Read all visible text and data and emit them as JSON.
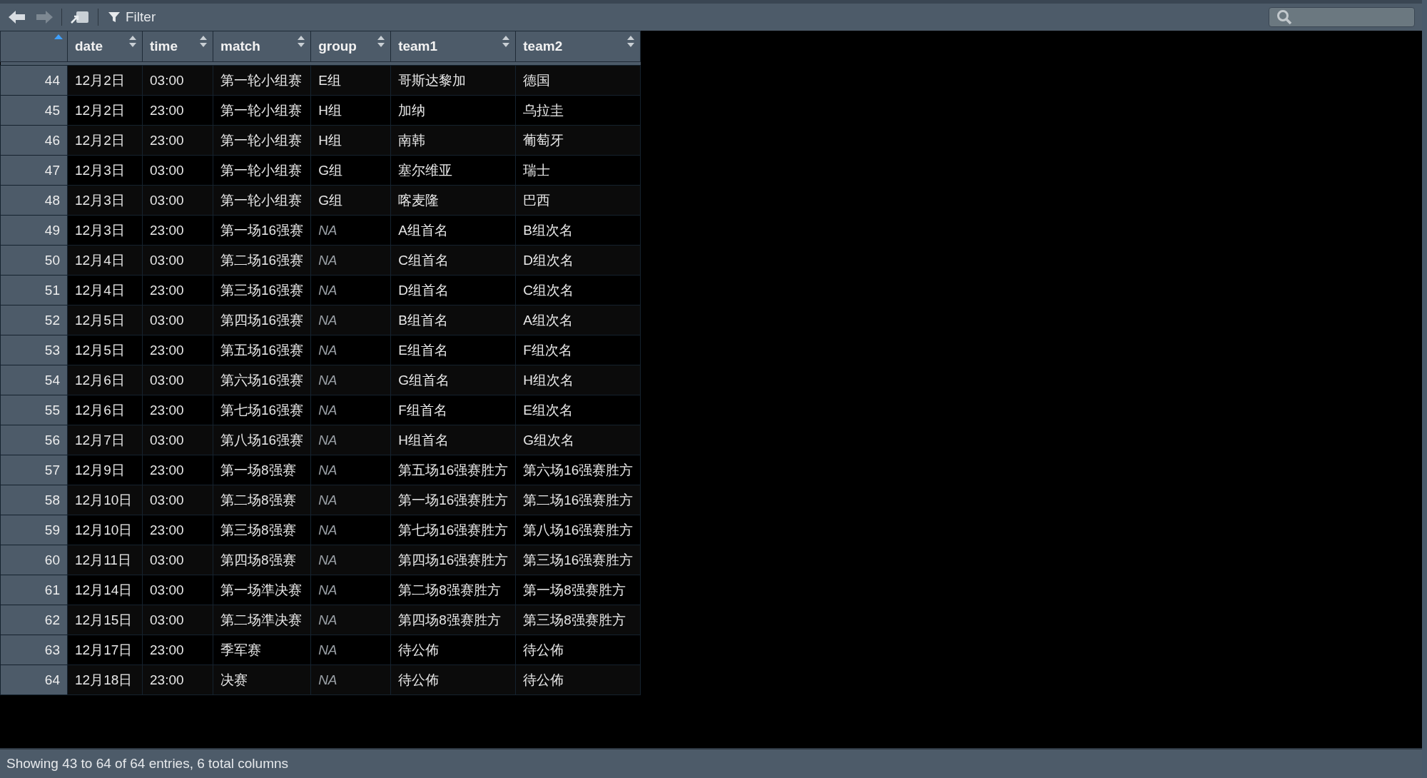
{
  "toolbar": {
    "back": {
      "disabled": false
    },
    "forward": {
      "disabled": true
    },
    "filter_label": "Filter"
  },
  "table": {
    "index_header": {
      "sorted_ascending": true
    },
    "columns": [
      {
        "label": "date",
        "sorted_ascending": false
      },
      {
        "label": "time",
        "sorted_ascending": false
      },
      {
        "label": "match",
        "sorted_ascending": false
      },
      {
        "label": "group",
        "sorted_ascending": false
      },
      {
        "label": "team1",
        "sorted_ascending": false
      },
      {
        "label": "team2",
        "sorted_ascending": false
      }
    ],
    "rows": [
      {
        "index": "44",
        "cells": [
          {
            "text": "12月2日",
            "missing": false
          },
          {
            "text": "03:00",
            "missing": false
          },
          {
            "text": "第一轮小组赛",
            "missing": false
          },
          {
            "text": "E组",
            "missing": false
          },
          {
            "text": "哥斯达黎加",
            "missing": false
          },
          {
            "text": "德国",
            "missing": false
          }
        ]
      },
      {
        "index": "45",
        "cells": [
          {
            "text": "12月2日",
            "missing": false
          },
          {
            "text": "23:00",
            "missing": false
          },
          {
            "text": "第一轮小组赛",
            "missing": false
          },
          {
            "text": "H组",
            "missing": false
          },
          {
            "text": "加纳",
            "missing": false
          },
          {
            "text": "乌拉圭",
            "missing": false
          }
        ]
      },
      {
        "index": "46",
        "cells": [
          {
            "text": "12月2日",
            "missing": false
          },
          {
            "text": "23:00",
            "missing": false
          },
          {
            "text": "第一轮小组赛",
            "missing": false
          },
          {
            "text": "H组",
            "missing": false
          },
          {
            "text": "南韩",
            "missing": false
          },
          {
            "text": "葡萄牙",
            "missing": false
          }
        ]
      },
      {
        "index": "47",
        "cells": [
          {
            "text": "12月3日",
            "missing": false
          },
          {
            "text": "03:00",
            "missing": false
          },
          {
            "text": "第一轮小组赛",
            "missing": false
          },
          {
            "text": "G组",
            "missing": false
          },
          {
            "text": "塞尔维亚",
            "missing": false
          },
          {
            "text": "瑞士",
            "missing": false
          }
        ]
      },
      {
        "index": "48",
        "cells": [
          {
            "text": "12月3日",
            "missing": false
          },
          {
            "text": "03:00",
            "missing": false
          },
          {
            "text": "第一轮小组赛",
            "missing": false
          },
          {
            "text": "G组",
            "missing": false
          },
          {
            "text": "喀麦隆",
            "missing": false
          },
          {
            "text": "巴西",
            "missing": false
          }
        ]
      },
      {
        "index": "49",
        "cells": [
          {
            "text": "12月3日",
            "missing": false
          },
          {
            "text": "23:00",
            "missing": false
          },
          {
            "text": "第一场16强赛",
            "missing": false
          },
          {
            "text": "NA",
            "missing": true
          },
          {
            "text": "A组首名",
            "missing": false
          },
          {
            "text": "B组次名",
            "missing": false
          }
        ]
      },
      {
        "index": "50",
        "cells": [
          {
            "text": "12月4日",
            "missing": false
          },
          {
            "text": "03:00",
            "missing": false
          },
          {
            "text": "第二场16强赛",
            "missing": false
          },
          {
            "text": "NA",
            "missing": true
          },
          {
            "text": "C组首名",
            "missing": false
          },
          {
            "text": "D组次名",
            "missing": false
          }
        ]
      },
      {
        "index": "51",
        "cells": [
          {
            "text": "12月4日",
            "missing": false
          },
          {
            "text": "23:00",
            "missing": false
          },
          {
            "text": "第三场16强赛",
            "missing": false
          },
          {
            "text": "NA",
            "missing": true
          },
          {
            "text": "D组首名",
            "missing": false
          },
          {
            "text": "C组次名",
            "missing": false
          }
        ]
      },
      {
        "index": "52",
        "cells": [
          {
            "text": "12月5日",
            "missing": false
          },
          {
            "text": "03:00",
            "missing": false
          },
          {
            "text": "第四场16强赛",
            "missing": false
          },
          {
            "text": "NA",
            "missing": true
          },
          {
            "text": "B组首名",
            "missing": false
          },
          {
            "text": "A组次名",
            "missing": false
          }
        ]
      },
      {
        "index": "53",
        "cells": [
          {
            "text": "12月5日",
            "missing": false
          },
          {
            "text": "23:00",
            "missing": false
          },
          {
            "text": "第五场16强赛",
            "missing": false
          },
          {
            "text": "NA",
            "missing": true
          },
          {
            "text": "E组首名",
            "missing": false
          },
          {
            "text": "F组次名",
            "missing": false
          }
        ]
      },
      {
        "index": "54",
        "cells": [
          {
            "text": "12月6日",
            "missing": false
          },
          {
            "text": "03:00",
            "missing": false
          },
          {
            "text": "第六场16强赛",
            "missing": false
          },
          {
            "text": "NA",
            "missing": true
          },
          {
            "text": "G组首名",
            "missing": false
          },
          {
            "text": "H组次名",
            "missing": false
          }
        ]
      },
      {
        "index": "55",
        "cells": [
          {
            "text": "12月6日",
            "missing": false
          },
          {
            "text": "23:00",
            "missing": false
          },
          {
            "text": "第七场16强赛",
            "missing": false
          },
          {
            "text": "NA",
            "missing": true
          },
          {
            "text": "F组首名",
            "missing": false
          },
          {
            "text": "E组次名",
            "missing": false
          }
        ]
      },
      {
        "index": "56",
        "cells": [
          {
            "text": "12月7日",
            "missing": false
          },
          {
            "text": "03:00",
            "missing": false
          },
          {
            "text": "第八场16强赛",
            "missing": false
          },
          {
            "text": "NA",
            "missing": true
          },
          {
            "text": "H组首名",
            "missing": false
          },
          {
            "text": "G组次名",
            "missing": false
          }
        ]
      },
      {
        "index": "57",
        "cells": [
          {
            "text": "12月9日",
            "missing": false
          },
          {
            "text": "23:00",
            "missing": false
          },
          {
            "text": "第一场8强赛",
            "missing": false
          },
          {
            "text": "NA",
            "missing": true
          },
          {
            "text": "第五场16强赛胜方",
            "missing": false
          },
          {
            "text": "第六场16强赛胜方",
            "missing": false
          }
        ]
      },
      {
        "index": "58",
        "cells": [
          {
            "text": "12月10日",
            "missing": false
          },
          {
            "text": "03:00",
            "missing": false
          },
          {
            "text": "第二场8强赛",
            "missing": false
          },
          {
            "text": "NA",
            "missing": true
          },
          {
            "text": "第一场16强赛胜方",
            "missing": false
          },
          {
            "text": "第二场16强赛胜方",
            "missing": false
          }
        ]
      },
      {
        "index": "59",
        "cells": [
          {
            "text": "12月10日",
            "missing": false
          },
          {
            "text": "23:00",
            "missing": false
          },
          {
            "text": "第三场8强赛",
            "missing": false
          },
          {
            "text": "NA",
            "missing": true
          },
          {
            "text": "第七场16强赛胜方",
            "missing": false
          },
          {
            "text": "第八场16强赛胜方",
            "missing": false
          }
        ]
      },
      {
        "index": "60",
        "cells": [
          {
            "text": "12月11日",
            "missing": false
          },
          {
            "text": "03:00",
            "missing": false
          },
          {
            "text": "第四场8强赛",
            "missing": false
          },
          {
            "text": "NA",
            "missing": true
          },
          {
            "text": "第四场16强赛胜方",
            "missing": false
          },
          {
            "text": "第三场16强赛胜方",
            "missing": false
          }
        ]
      },
      {
        "index": "61",
        "cells": [
          {
            "text": "12月14日",
            "missing": false
          },
          {
            "text": "03:00",
            "missing": false
          },
          {
            "text": "第一场準决赛",
            "missing": false
          },
          {
            "text": "NA",
            "missing": true
          },
          {
            "text": "第二场8强赛胜方",
            "missing": false
          },
          {
            "text": "第一场8强赛胜方",
            "missing": false
          }
        ]
      },
      {
        "index": "62",
        "cells": [
          {
            "text": "12月15日",
            "missing": false
          },
          {
            "text": "03:00",
            "missing": false
          },
          {
            "text": "第二场準决赛",
            "missing": false
          },
          {
            "text": "NA",
            "missing": true
          },
          {
            "text": "第四场8强赛胜方",
            "missing": false
          },
          {
            "text": "第三场8强赛胜方",
            "missing": false
          }
        ]
      },
      {
        "index": "63",
        "cells": [
          {
            "text": "12月17日",
            "missing": false
          },
          {
            "text": "23:00",
            "missing": false
          },
          {
            "text": "季军赛",
            "missing": false
          },
          {
            "text": "NA",
            "missing": true
          },
          {
            "text": "待公佈",
            "missing": false
          },
          {
            "text": "待公佈",
            "missing": false
          }
        ]
      },
      {
        "index": "64",
        "cells": [
          {
            "text": "12月18日",
            "missing": false
          },
          {
            "text": "23:00",
            "missing": false
          },
          {
            "text": "决赛",
            "missing": false
          },
          {
            "text": "NA",
            "missing": true
          },
          {
            "text": "待公佈",
            "missing": false
          },
          {
            "text": "待公佈",
            "missing": false
          }
        ]
      }
    ]
  },
  "status_bar": {
    "text": "Showing 43 to 64 of 64 entries, 6 total columns"
  }
}
